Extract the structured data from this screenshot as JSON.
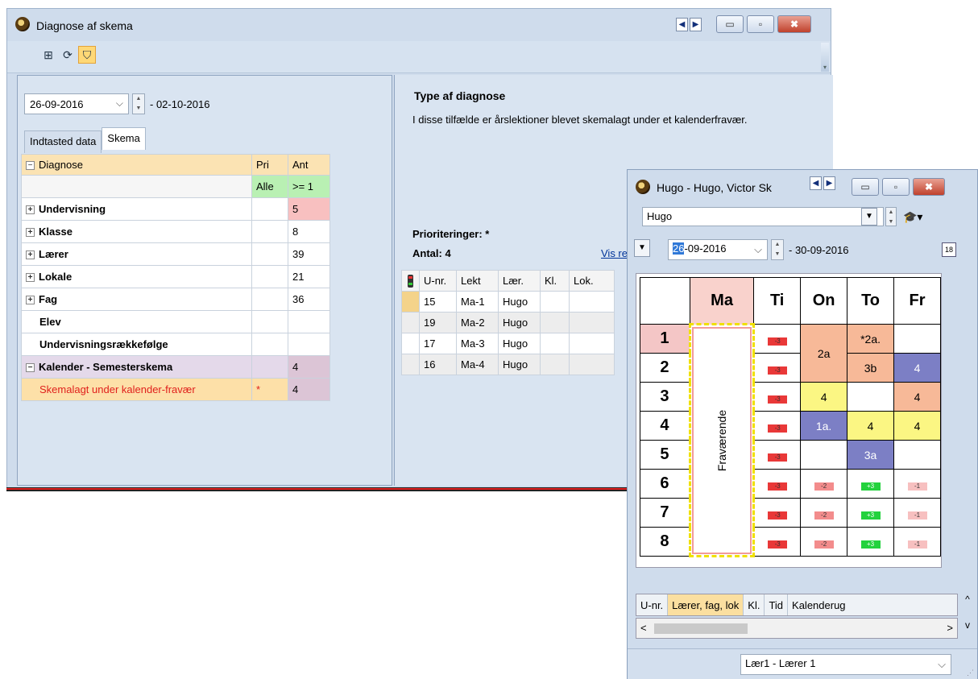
{
  "main_window": {
    "title": "Diagnose af skema",
    "nav_prev": "◀",
    "nav_next": "▶",
    "minimize": "▭",
    "maximize": "▫",
    "close": "✖",
    "toolbar": {
      "icon1": "⊞",
      "icon2": "⟳",
      "icon3": "⛉",
      "grip": "▾"
    },
    "date_from": "26-09-2016",
    "date_to": "- 02-10-2016",
    "tabs": [
      "Indtasted data",
      "Skema"
    ],
    "table": {
      "header": [
        "Diagnose",
        "Pri",
        "Ant"
      ],
      "filter": [
        "Alle",
        ">= 1"
      ],
      "rows": [
        {
          "name": "Undervisning",
          "pri": "",
          "ant": "5"
        },
        {
          "name": "Klasse",
          "pri": "",
          "ant": "8"
        },
        {
          "name": "Lærer",
          "pri": "",
          "ant": "39"
        },
        {
          "name": "Lokale",
          "pri": "",
          "ant": "21"
        },
        {
          "name": "Fag",
          "pri": "",
          "ant": "36"
        },
        {
          "name": "Elev",
          "pri": "",
          "ant": ""
        },
        {
          "name": "Undervisningsrækkefølge",
          "pri": "",
          "ant": ""
        },
        {
          "name": "Kalender - Semesterskema",
          "pri": "",
          "ant": "4"
        },
        {
          "name": "Skemalagt under kalender-fravær",
          "pri": "*",
          "ant": "4"
        }
      ]
    },
    "right": {
      "type_title": "Type af diagnose",
      "type_desc": "I disse tilfælde er årslektioner blevet skemalagt under et kalenderfravær.",
      "priorities": "Prioriteringer: *",
      "count": "Antal: 4",
      "show_link": "Vis re",
      "lessons_header": [
        "U-nr.",
        "Lekt",
        "Lær.",
        "Kl.",
        "Lok."
      ],
      "lessons": [
        [
          "15",
          "Ma-1",
          "Hugo",
          "",
          ""
        ],
        [
          "19",
          "Ma-2",
          "Hugo",
          "",
          ""
        ],
        [
          "17",
          "Ma-3",
          "Hugo",
          "",
          ""
        ],
        [
          "16",
          "Ma-4",
          "Hugo",
          "",
          ""
        ]
      ]
    }
  },
  "popup": {
    "title": "Hugo - Hugo, Victor Sk",
    "teacher": "Hugo",
    "date_sel": "26",
    "date_rest": "-09-2016",
    "date_to": "- 30-09-2016",
    "calendar_icon": "18",
    "days": [
      "Ma",
      "Ti",
      "On",
      "To",
      "Fr"
    ],
    "periods": [
      "1",
      "2",
      "3",
      "4",
      "5",
      "6",
      "7",
      "8"
    ],
    "fravaer": "Fraværende",
    "cells": {
      "on_12": "2a",
      "to_1": "*2a.",
      "to_2": "3b",
      "fr_2": "4",
      "on_3": "4",
      "fr_3": "4",
      "on_4": "1a.",
      "to_4": "4",
      "fr_4": "4",
      "to_5": "3a",
      "m3": "-3",
      "m2": "-2",
      "p3": "+3",
      "m1": "-1"
    },
    "bottom_tabs": [
      "U-nr.",
      "Lærer, fag, lok",
      "Kl.",
      "Tid",
      "Kalenderug"
    ],
    "status_combo": "Lær1 - Lærer 1",
    "arrow_left": "<",
    "arrow_right": ">",
    "arrow_up": "^",
    "arrow_down": "v"
  },
  "colors": {
    "window_bg": "#cfdcec",
    "selection": "#fbdfa0",
    "absence_red": "#e93838",
    "orange_lesson": "#f7b998",
    "purple_lesson": "#7c7fc5",
    "yellow_lesson": "#fbf683"
  }
}
